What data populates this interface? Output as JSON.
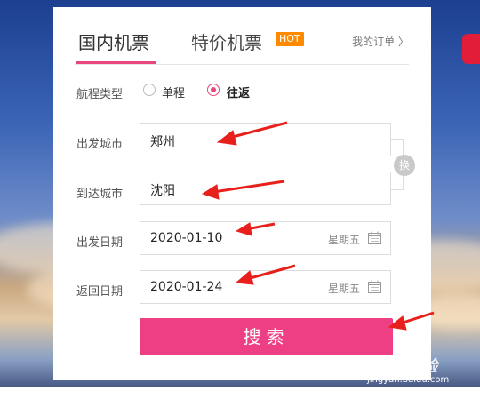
{
  "tabs": {
    "domestic": "国内机票",
    "special": "特价机票",
    "hot_badge": "HOT",
    "my_orders": "我的订单 〉"
  },
  "trip_type": {
    "label": "航程类型",
    "options": [
      "单程",
      "往返"
    ],
    "selected": "往返"
  },
  "form": {
    "from_label": "出发城市",
    "from_value": "郑州",
    "to_label": "到达城市",
    "to_value": "沈阳",
    "swap_label": "换",
    "depart_label": "出发日期",
    "depart_value": "2020-01-10",
    "depart_weekday": "星期五",
    "return_label": "返回日期",
    "return_value": "2020-01-24",
    "return_weekday": "星期五"
  },
  "search_label": "搜索",
  "watermark": {
    "logo": "Bai 经验",
    "url": "jingyan.baidu.com"
  },
  "colors": {
    "accent": "#ee3f84",
    "hot": "#ff8a00",
    "arrow": "#e8201c"
  },
  "icons": [
    "calendar-icon",
    "swap-icon",
    "chevron-right-icon",
    "arrow-annotation"
  ]
}
